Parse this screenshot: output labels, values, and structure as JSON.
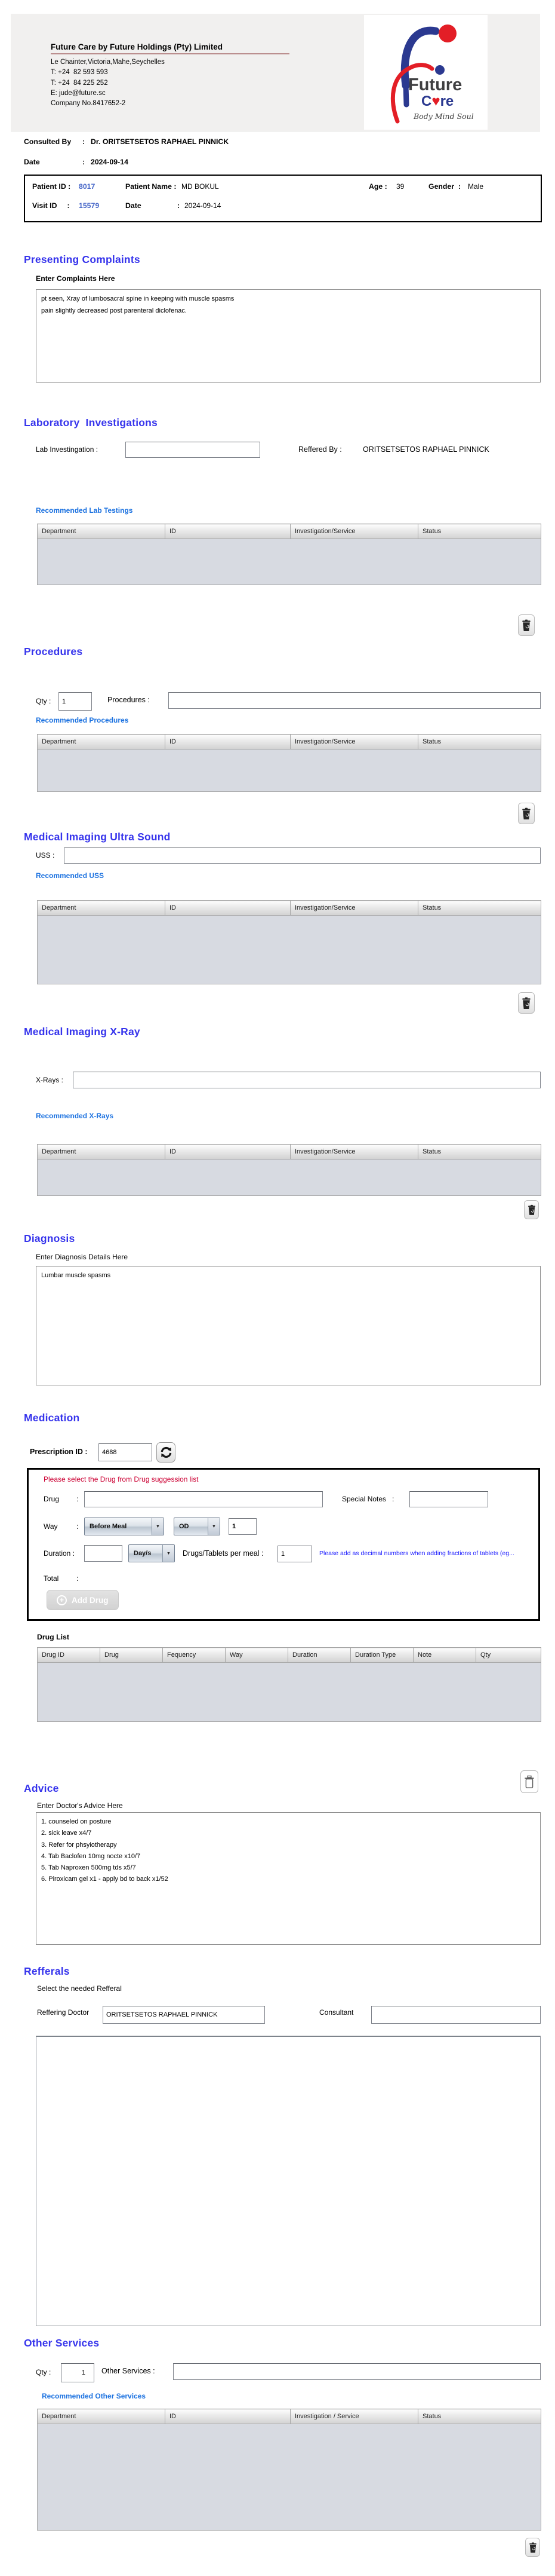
{
  "ui": {
    "colon": ":"
  },
  "header": {
    "company_title": "Future Care by Future Holdings (Pty) Limited",
    "address": "Le Chainter,Victoria,Mahe,Seychelles",
    "phone1": "T: +24  82 593 593",
    "phone2": "T: +24  84 225 252",
    "email": "E: jude@future.sc",
    "company_no": "Company No.8417652-2",
    "logo": {
      "word1": "Future",
      "word2_left": "C",
      "word2_heart": "♥",
      "word2_right": "re",
      "tagline": "Body Mind Soul"
    }
  },
  "consult": {
    "consulted_by_label": "Consulted By",
    "consulted_by_value": "Dr.  ORITSETSETOS RAPHAEL PINNICK",
    "date_label": "Date",
    "date_value": "2024-09-14"
  },
  "patient": {
    "patient_id_label": "Patient ID :",
    "patient_id": "8017",
    "patient_name_label": "Patient Name :",
    "patient_name": "MD BOKUL",
    "age_label": "Age :",
    "age": "39",
    "gender_label": "Gender  :",
    "gender": "Male",
    "visit_id_label": "Visit ID     :",
    "visit_id": "15579",
    "visit_date_label": "Date",
    "visit_date": "2024-09-14"
  },
  "complaints": {
    "title": "Presenting Complaints",
    "label": "Enter Complaints Here",
    "text": "pt seen, Xray of lumbosacral spine in keeping with muscle spasms\npain slightly decreased post parenteral diclofenac."
  },
  "lab": {
    "title": "Laboratory  Investigations",
    "input_label": "Lab Investingation :",
    "referred_by_label": "Reffered By :",
    "referred_by": "ORITSETSETOS RAPHAEL PINNICK",
    "link": "Recommended Lab Testings",
    "headers": [
      "Department",
      "ID",
      "Investigation/Service",
      "Status"
    ]
  },
  "procedures": {
    "title": "Procedures",
    "qty_label": "Qty :",
    "qty_value": "1",
    "input_label": "Procedures :",
    "link": "Recommended Procedures",
    "headers": [
      "Department",
      "ID",
      "Investigation/Service",
      "Status"
    ]
  },
  "uss": {
    "title": "Medical Imaging Ultra Sound",
    "input_label": "USS :",
    "link": "Recommended USS",
    "headers": [
      "Department",
      "ID",
      "Investigation/Service",
      "Status"
    ]
  },
  "xray": {
    "title": "Medical Imaging X-Ray",
    "input_label": "X-Rays :",
    "link": "Recommended X-Rays",
    "headers": [
      "Department",
      "ID",
      "Investigation/Service",
      "Status"
    ]
  },
  "diagnosis": {
    "title": "Diagnosis",
    "label": "Enter Diagnosis Details Here",
    "text": "Lumbar muscle spasms"
  },
  "medication": {
    "title": "Medication",
    "prescription_label": "Prescription ID :",
    "prescription_id": "4688",
    "warning": "Please select the Drug from Drug suggession list",
    "drug_label": "Drug",
    "special_notes_label": "Special Notes   :",
    "way_label": "Way",
    "meal_select": "Before Meal",
    "frequency_select": "OD",
    "way_qty": "1",
    "duration_label": "Duration :",
    "duration_type_select": "Day/s",
    "per_meal_label": "Drugs/Tablets per meal :",
    "per_meal_value": "1",
    "hint": "Please add as decimal numbers when adding fractions of tablets (eg...",
    "total_label": "Total",
    "add_drug_label": "Add Drug",
    "drug_list_label": "Drug List",
    "headers": [
      "Drug ID",
      "Drug",
      "Fequency",
      "Way",
      "Duration",
      "Duration Type",
      "Note",
      "Qty"
    ]
  },
  "advice": {
    "title": "Advice",
    "label": "Enter Doctor's Advice Here",
    "text": "1. counseled on posture\n2. sick leave x4/7\n3. Refer for phsyiotherapy\n4. Tab Baclofen 10mg nocte x10/7\n5. Tab Naproxen 500mg tds x5/7\n6. Piroxicam gel x1 - apply bd to back x1/52"
  },
  "referrals": {
    "title": "Refferals",
    "label": "Select the needed Refferal",
    "doctor_label": "Reffering Doctor",
    "doctor_value": "ORITSETSETOS RAPHAEL PINNICK",
    "consultant_label": "Consultant"
  },
  "other_services": {
    "title": "Other Services",
    "qty_label": "Qty :",
    "qty_value": "1",
    "input_label": "Other Services :",
    "link": "Recommended Other Services",
    "headers": [
      "Department",
      "ID",
      "Investigation / Service",
      "Status"
    ]
  }
}
